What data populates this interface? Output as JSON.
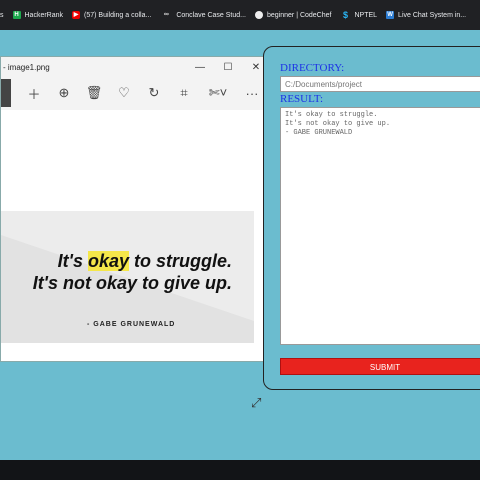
{
  "bookmarks": [
    {
      "label": "s",
      "icon": "bookmark-icon"
    },
    {
      "label": "HackerRank",
      "icon": "hackerrank-icon"
    },
    {
      "label": "(57) Building a colla...",
      "icon": "youtube-icon"
    },
    {
      "label": "Conclave Case Stud...",
      "icon": "link-icon"
    },
    {
      "label": "beginner | CodeChef",
      "icon": "github-icon"
    },
    {
      "label": "NPTEL",
      "icon": "nptel-icon"
    },
    {
      "label": "Live Chat System in...",
      "icon": "word-icon"
    }
  ],
  "photos": {
    "title": "- image1.png",
    "quote_line1_pre": "It's ",
    "quote_highlight": "okay",
    "quote_line1_post": " to struggle.",
    "quote_line2": "It's not okay to give up.",
    "quote_author": "- GABE GRUNEWALD",
    "highlight_color": "#f5e74a"
  },
  "form": {
    "directory_label": "DIRECTORY:",
    "directory_placeholder": "C:/Documents/project",
    "result_label": "RESULT:",
    "result_lines": [
      "It's okay to struggle.",
      "It's not okay to give up.",
      "- GABE GRUNEWALD"
    ],
    "submit_label": "SUBMIT",
    "label_color": "#1d33e6",
    "submit_color": "#e8231e"
  }
}
